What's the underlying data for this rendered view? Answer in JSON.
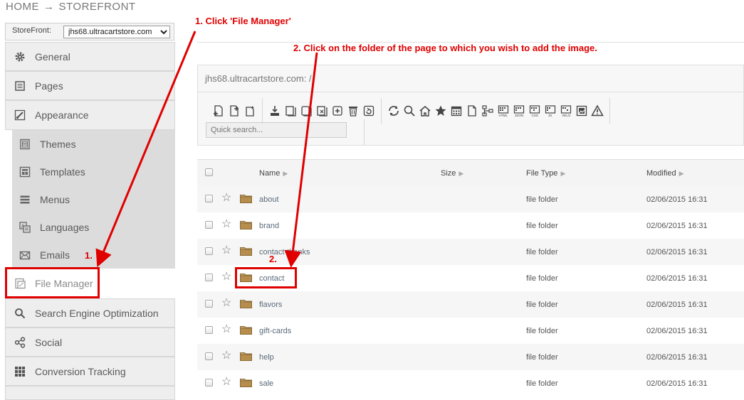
{
  "breadcrumb": {
    "home": "HOME",
    "arrow": "→",
    "current": "STOREFRONT"
  },
  "storefront": {
    "label": "StoreFront:",
    "selected": "jhs68.ultracartstore.com"
  },
  "sidebar": {
    "items": [
      {
        "label": "General",
        "icon": "gear-icon"
      },
      {
        "label": "Pages",
        "icon": "pages-icon"
      },
      {
        "label": "Appearance",
        "icon": "brush-icon"
      }
    ],
    "subitems": [
      {
        "label": "Themes",
        "icon": "themes-icon"
      },
      {
        "label": "Templates",
        "icon": "templates-icon"
      },
      {
        "label": "Menus",
        "icon": "menu-icon"
      },
      {
        "label": "Languages",
        "icon": "languages-icon"
      },
      {
        "label": "Emails",
        "icon": "email-icon"
      }
    ],
    "lower": [
      {
        "label": "File Manager",
        "icon": "file-manager-icon"
      },
      {
        "label": "Search Engine Optimization",
        "icon": "search-icon"
      },
      {
        "label": "Social",
        "icon": "share-icon"
      },
      {
        "label": "Conversion Tracking",
        "icon": "grid-icon"
      }
    ]
  },
  "file_manager": {
    "path": "jhs68.ultracartstore.com: /",
    "quick_search_placeholder": "Quick search...",
    "columns": {
      "name": "Name",
      "size": "Size",
      "type": "File Type",
      "modified": "Modified"
    },
    "rows": [
      {
        "name": "about",
        "type": "file folder",
        "modified": "02/06/2015 16:31"
      },
      {
        "name": "brand",
        "type": "file folder",
        "modified": "02/06/2015 16:31"
      },
      {
        "name": "contact-thanks",
        "type": "file folder",
        "modified": "02/06/2015 16:31"
      },
      {
        "name": "contact",
        "type": "file folder",
        "modified": "02/06/2015 16:31"
      },
      {
        "name": "flavors",
        "type": "file folder",
        "modified": "02/06/2015 16:31"
      },
      {
        "name": "gift-cards",
        "type": "file folder",
        "modified": "02/06/2015 16:31"
      },
      {
        "name": "help",
        "type": "file folder",
        "modified": "02/06/2015 16:31"
      },
      {
        "name": "sale",
        "type": "file folder",
        "modified": "02/06/2015 16:31"
      }
    ]
  },
  "annotations": {
    "step1": "1. Click 'File Manager'",
    "step2": "2. Click on the folder of the page to which you wish to add the image.",
    "step1_marker": "1.",
    "step2_marker": "2.",
    "color": "#e00000"
  }
}
